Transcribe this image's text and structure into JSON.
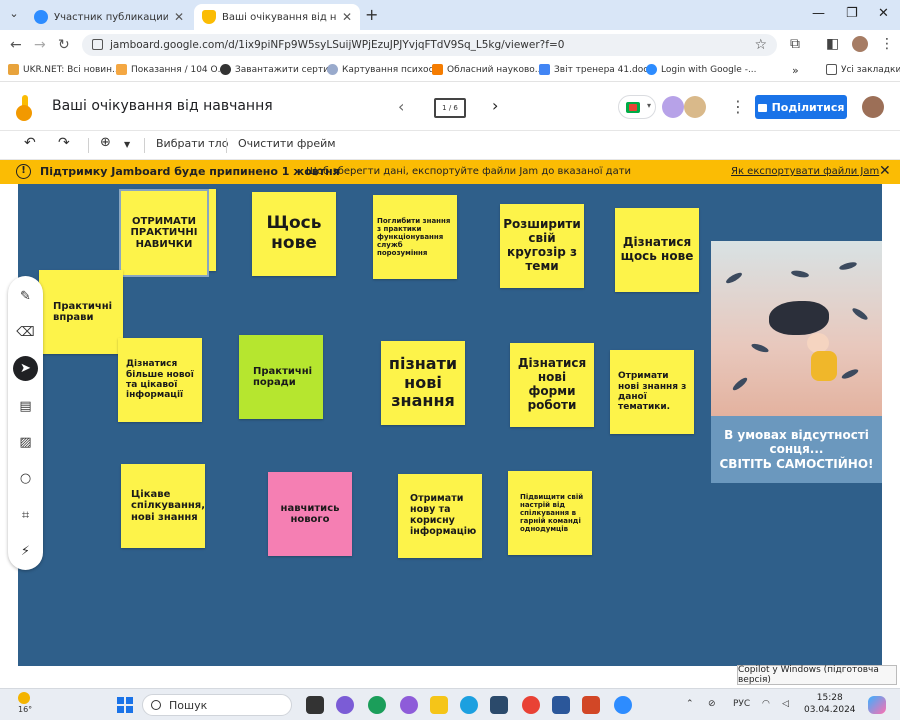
{
  "browser": {
    "tabs": [
      {
        "title": "Участник публикации - Zoom",
        "active": false
      },
      {
        "title": "Ваші очікування від навчання",
        "active": true
      }
    ],
    "url": "jamboard.google.com/d/1ix9piNFp9W5syLSuijWPjEzuJPJYvjqFTdV9Sq_L5kg/viewer?f=0",
    "bookmarks": [
      "UKR.NET: Всі новин...",
      "Показання / 104 О...",
      "Завантажити серти...",
      "Картування психос...",
      "Обласний науково...",
      "Звіт тренера 41.doc...",
      "Login with Google -..."
    ],
    "all_bookmarks": "Усі закладки"
  },
  "jamboard": {
    "title": "Ваші очікування від навчання",
    "frame_indicator": "1 / 6",
    "share_label": "Поділитися",
    "toolbar": {
      "set_background": "Вибрати тло",
      "clear_frame": "Очистити фрейм"
    },
    "banner": {
      "title": "Підтримку Jamboard буде припинено 1 жовтня",
      "description": "Щоб зберегти дані, експортуйте файли Jam до вказаної дати",
      "link": "Як експортувати файли Jam"
    }
  },
  "notes": [
    {
      "text": "ОТРИМАТИ ПРАКТИЧНІ НАВИЧКИ",
      "color": "#fdf34a"
    },
    {
      "text": "Щось нове",
      "color": "#fdf34a"
    },
    {
      "text": "Поглибити знання з практики функціонування служб порозуміння",
      "color": "#fdf34a"
    },
    {
      "text": "Розширити свій кругозір з теми",
      "color": "#fdf34a"
    },
    {
      "text": "Дізнатися щось нове",
      "color": "#fdf34a"
    },
    {
      "text": "Практичні вправи",
      "color": "#fdf34a"
    },
    {
      "text": "Дізнатися більше нової та цікавої інформації",
      "color": "#fdf34a"
    },
    {
      "text": "Практичні поради",
      "color": "#b6e62f"
    },
    {
      "text": "пізнати нові знання",
      "color": "#fdf34a"
    },
    {
      "text": "Дізнатися нові форми роботи",
      "color": "#fdf34a"
    },
    {
      "text": "Отримати нові знання з даної тематики.",
      "color": "#fdf34a"
    },
    {
      "text": "Цікаве спілкування, нові знання",
      "color": "#fdf34a"
    },
    {
      "text": "навчитись нового",
      "color": "#f57fb3"
    },
    {
      "text": "Отримати нову та корисну інформацію",
      "color": "#fdf34a"
    },
    {
      "text": "Підвищити свій настрій від спілкування в гарній команді однодумців",
      "color": "#fdf34a"
    }
  ],
  "poster": {
    "line1": "В умовах відсутності",
    "line2": "сонця...",
    "line3": "СВІТІТЬ САМОСТІЙНО!"
  },
  "taskbar": {
    "weather": "16°",
    "search_placeholder": "Пошук",
    "language": "РУС",
    "time": "15:28",
    "date": "03.04.2024"
  },
  "tooltip": "Copilot у Windows (підготовча версія)",
  "colors": {
    "canvas": "#2f5f8a",
    "banner": "#fbbc04",
    "share": "#1a73e8"
  }
}
